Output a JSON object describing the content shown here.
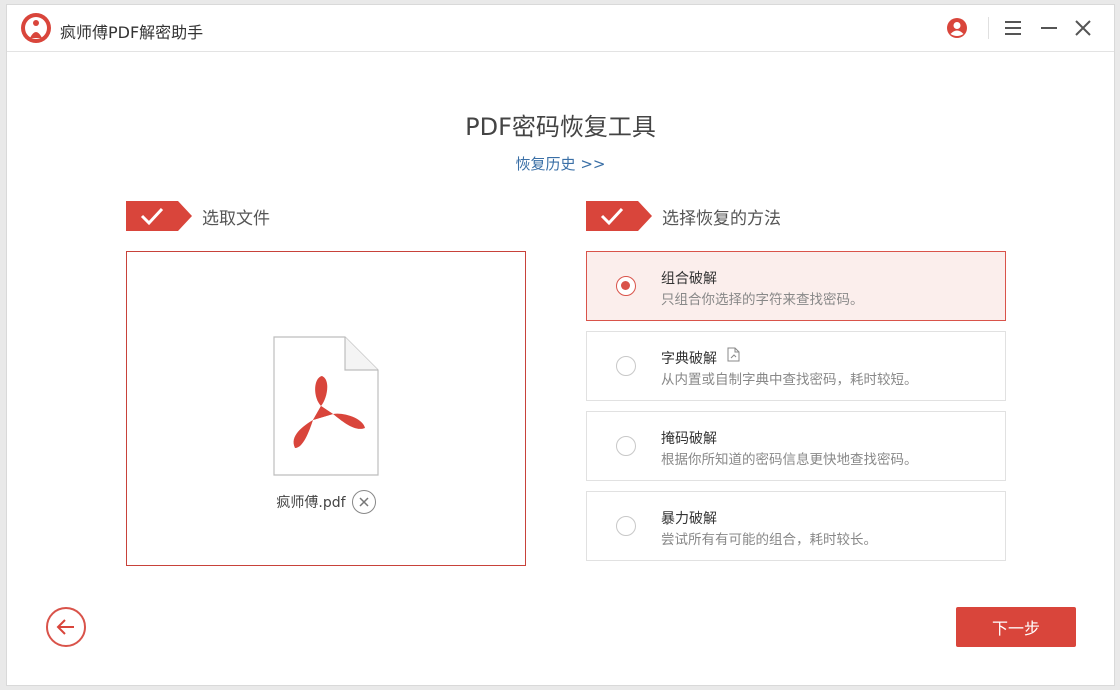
{
  "window": {
    "title": "疯师傅PDF解密助手"
  },
  "titlebar": {
    "icons": [
      "account-icon",
      "menu-icon",
      "minimize-icon",
      "close-icon"
    ]
  },
  "header": {
    "title": "PDF密码恢复工具",
    "history_link": "恢复历史 >>"
  },
  "steps": [
    {
      "label": "选取文件",
      "icon": "check-icon"
    },
    {
      "label": "选择恢复的方法",
      "icon": "check-icon"
    }
  ],
  "file": {
    "name": "疯师傅.pdf",
    "icon": "pdf-file-icon"
  },
  "options": [
    {
      "title": "组合破解",
      "desc": "只组合你选择的字符来查找密码。",
      "selected": true
    },
    {
      "title": "字典破解",
      "desc": "从内置或自制字典中查找密码，耗时较短。",
      "selected": false,
      "extra_icon": "file-icon"
    },
    {
      "title": "掩码破解",
      "desc": "根据你所知道的密码信息更快地查找密码。",
      "selected": false
    },
    {
      "title": "暴力破解",
      "desc": "尝试所有有可能的组合，耗时较长。",
      "selected": false
    }
  ],
  "footer": {
    "next_label": "下一步",
    "back_icon": "arrow-left-icon"
  },
  "colors": {
    "accent": "#d9453b",
    "selected_bg": "#fbeeec",
    "link": "#3a6fa6"
  }
}
